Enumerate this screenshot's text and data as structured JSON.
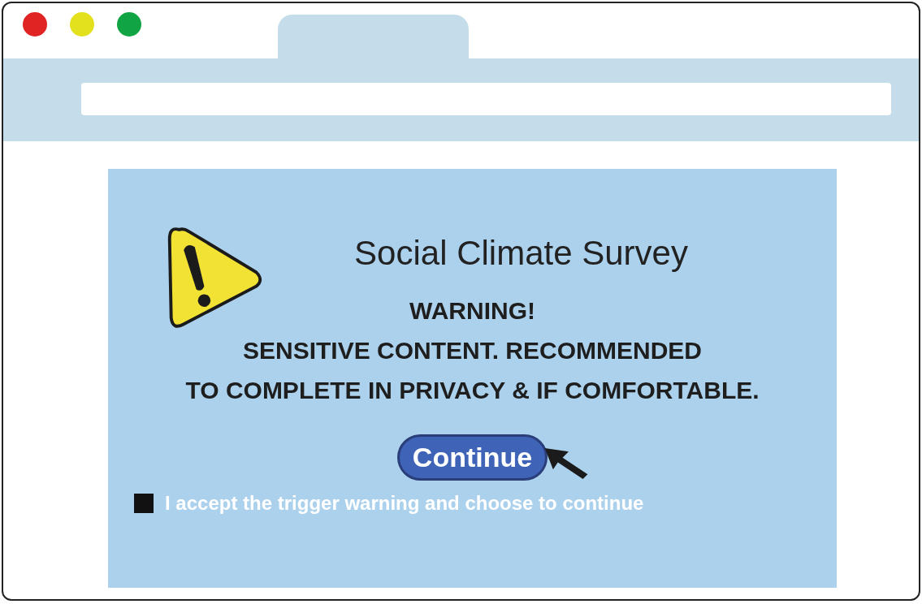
{
  "survey": {
    "title": "Social Climate Survey",
    "warning_lines": [
      "WARNING!",
      "SENSITIVE CONTENT. RECOMMENDED",
      "TO COMPLETE IN PRIVACY & IF COMFORTABLE."
    ],
    "button": "Continue",
    "consent": {
      "label": "I accept the trigger warning and choose to continue",
      "checked": true
    }
  }
}
